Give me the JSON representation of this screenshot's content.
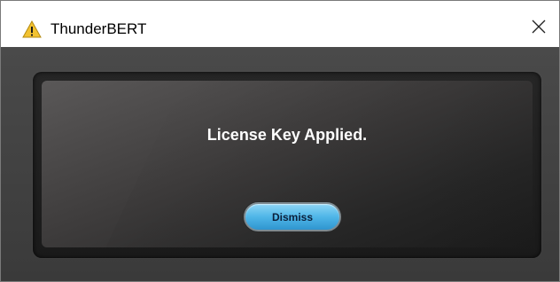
{
  "window": {
    "title": "ThunderBERT",
    "title_icon": "warning-icon",
    "close_icon": "close-icon"
  },
  "dialog": {
    "message": "License Key Applied.",
    "dismiss_label": "Dismiss"
  },
  "colors": {
    "warning_icon_fill": "#f2c231",
    "button_accent": "#4fb6e8",
    "panel_background": "#3e3c3c",
    "message_text": "#ffffff"
  }
}
